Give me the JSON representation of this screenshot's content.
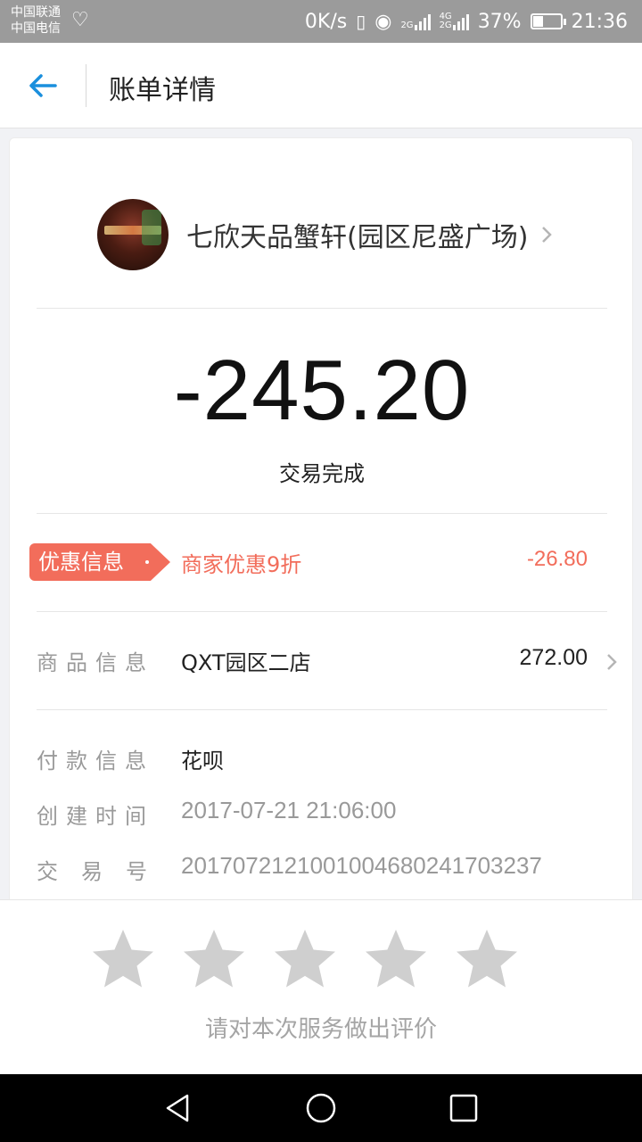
{
  "status_bar": {
    "carrier1": "中国联通",
    "carrier2": "中国电信",
    "speed": "0K/s",
    "net1": "2G",
    "net2": "4G",
    "net3": "2G",
    "battery": "37%",
    "battery_level": 0.37,
    "time": "21:36"
  },
  "header": {
    "title": "账单详情"
  },
  "merchant": {
    "name": "七欣天品蟹轩(园区尼盛广场)"
  },
  "transaction": {
    "amount": "-245.20",
    "status": "交易完成"
  },
  "discount": {
    "tag": "优惠信息",
    "desc": "商家优惠9折",
    "amount": "-26.80"
  },
  "details": {
    "goods_label": "商品信息",
    "goods_value": "QXT园区二店",
    "goods_price": "272.00",
    "payment_label": "付款信息",
    "payment_value": "花呗",
    "created_label": "创建时间",
    "created_value": "2017-07-21 21:06:00",
    "txn_label": "交易号",
    "txn_value": "2017072121001004680241703237"
  },
  "rating": {
    "prompt": "请对本次服务做出评价",
    "stars_total": 5,
    "stars_selected": 0
  },
  "colors": {
    "accent": "#1a8fdd",
    "discount": "#f26d5b",
    "star_empty": "#cfcfcf"
  }
}
